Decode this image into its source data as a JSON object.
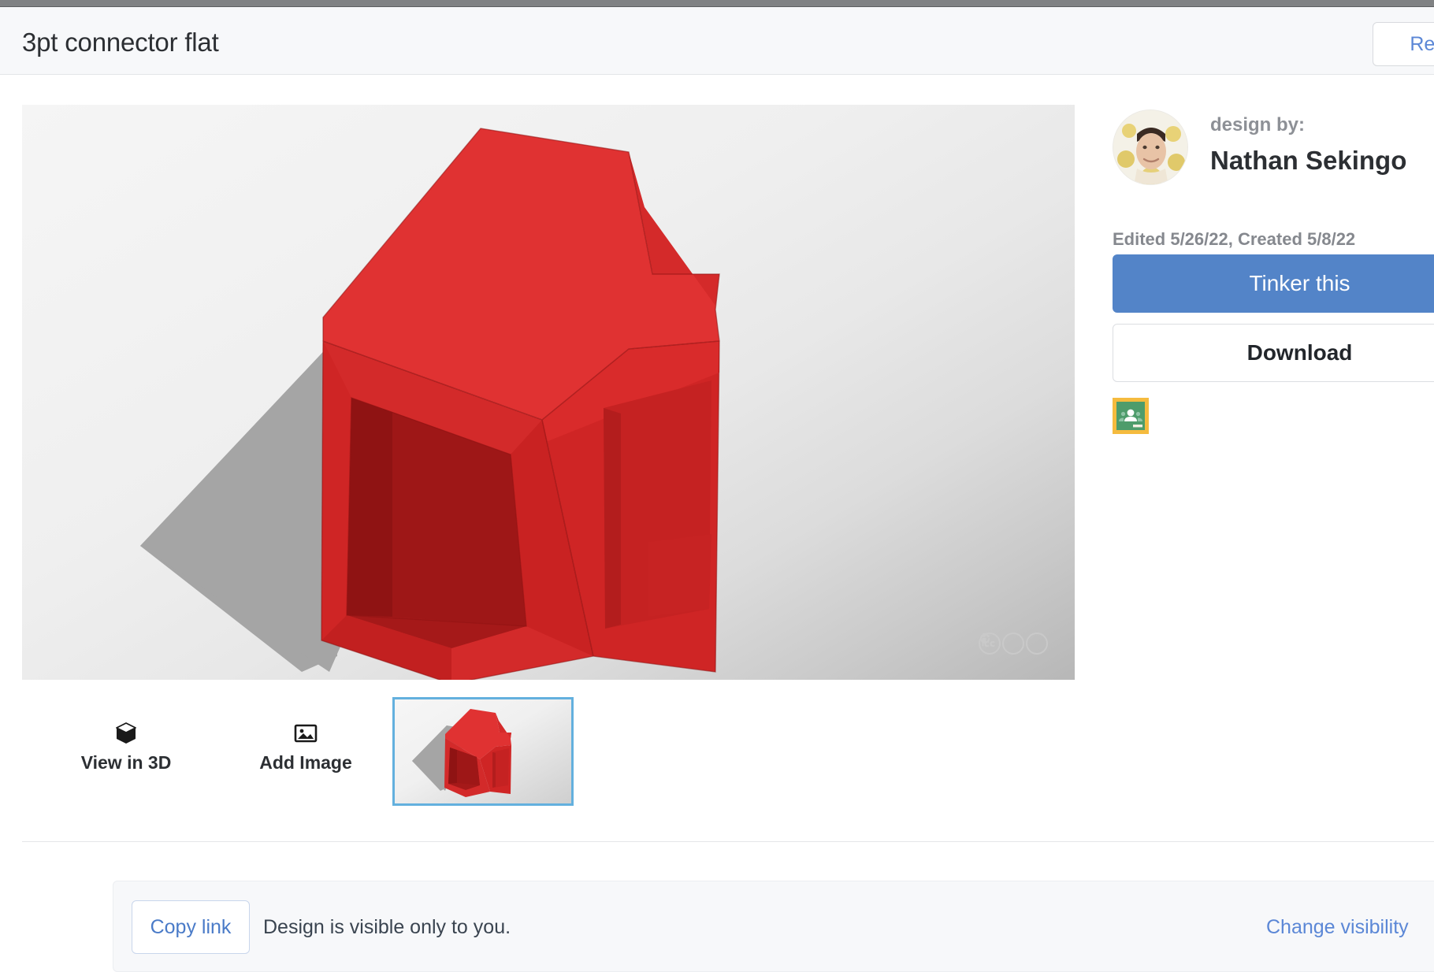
{
  "header": {
    "title": "3pt connector flat",
    "react_label": "React"
  },
  "viewer": {
    "license_badges": [
      "cc",
      "attribution",
      "share-alike"
    ]
  },
  "tools": [
    {
      "label": "View in 3D",
      "icon": "cube-3d-icon"
    },
    {
      "label": "Add Image",
      "icon": "image-icon"
    }
  ],
  "thumbnail": {
    "selected": "true"
  },
  "sidebar": {
    "design_by_label": "design by:",
    "author_name": "Nathan Sekingo",
    "dates": "Edited 5/26/22, Created 5/8/22",
    "tinker_label": "Tinker this",
    "download_label": "Download",
    "classroom_icon": "google-classroom-icon"
  },
  "notice": {
    "copy_link_label": "Copy link",
    "message": "Design is visible only to you.",
    "change_visibility_label": "Change visibility"
  },
  "colors": {
    "accent_blue": "#5384c8",
    "link_blue": "#5b87d6",
    "model_red": "#d92b2b",
    "model_red_dark": "#9e1717",
    "thumb_border": "#63b0de",
    "header_bg": "#f7f8fa",
    "top_strip": "#808284",
    "classroom_green": "#4e9c6b",
    "classroom_yellow": "#f5bb3e"
  }
}
